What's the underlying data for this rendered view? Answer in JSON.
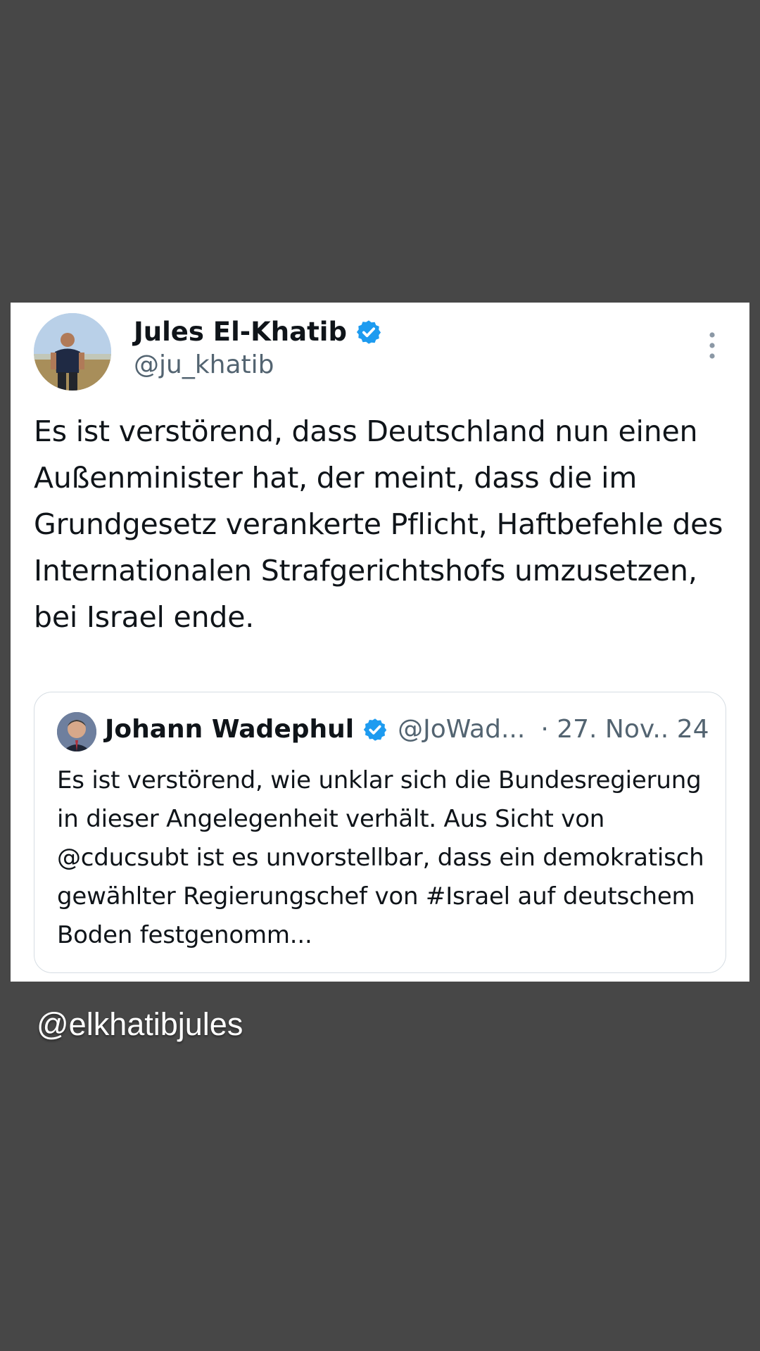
{
  "tweet": {
    "author_name": "Jules El-Khatib",
    "author_handle": "@ju_khatib",
    "verified_icon": "verified-badge-icon",
    "more_icon": "more-options-icon",
    "text": "Es ist verstörend, dass Deutschland nun einen Außenminister hat, der meint, dass die im Grundgesetz verankerte Pflicht, Haftbefehle des Internationalen Strafgerichtshofs umzusetzen, bei Israel ende.",
    "quoted": {
      "author_name": "Johann Wadephul",
      "author_handle": "@JoWad...",
      "date": "· 27. Nov.. 24",
      "text": "Es ist verstörend, wie unklar sich die Bundesregierung in dieser Angelegenheit verhält. Aus Sicht von @cducsubt ist es unvorstellbar, dass ein demokratisch gewählter Regierungschef von #Israel auf deutschem Boden festgenomm..."
    }
  },
  "watermark": "@elkhatibjules",
  "colors": {
    "background": "#474747",
    "card": "#ffffff",
    "text_primary": "#0f1419",
    "text_secondary": "#536471",
    "verified_blue": "#1d9bf0"
  }
}
